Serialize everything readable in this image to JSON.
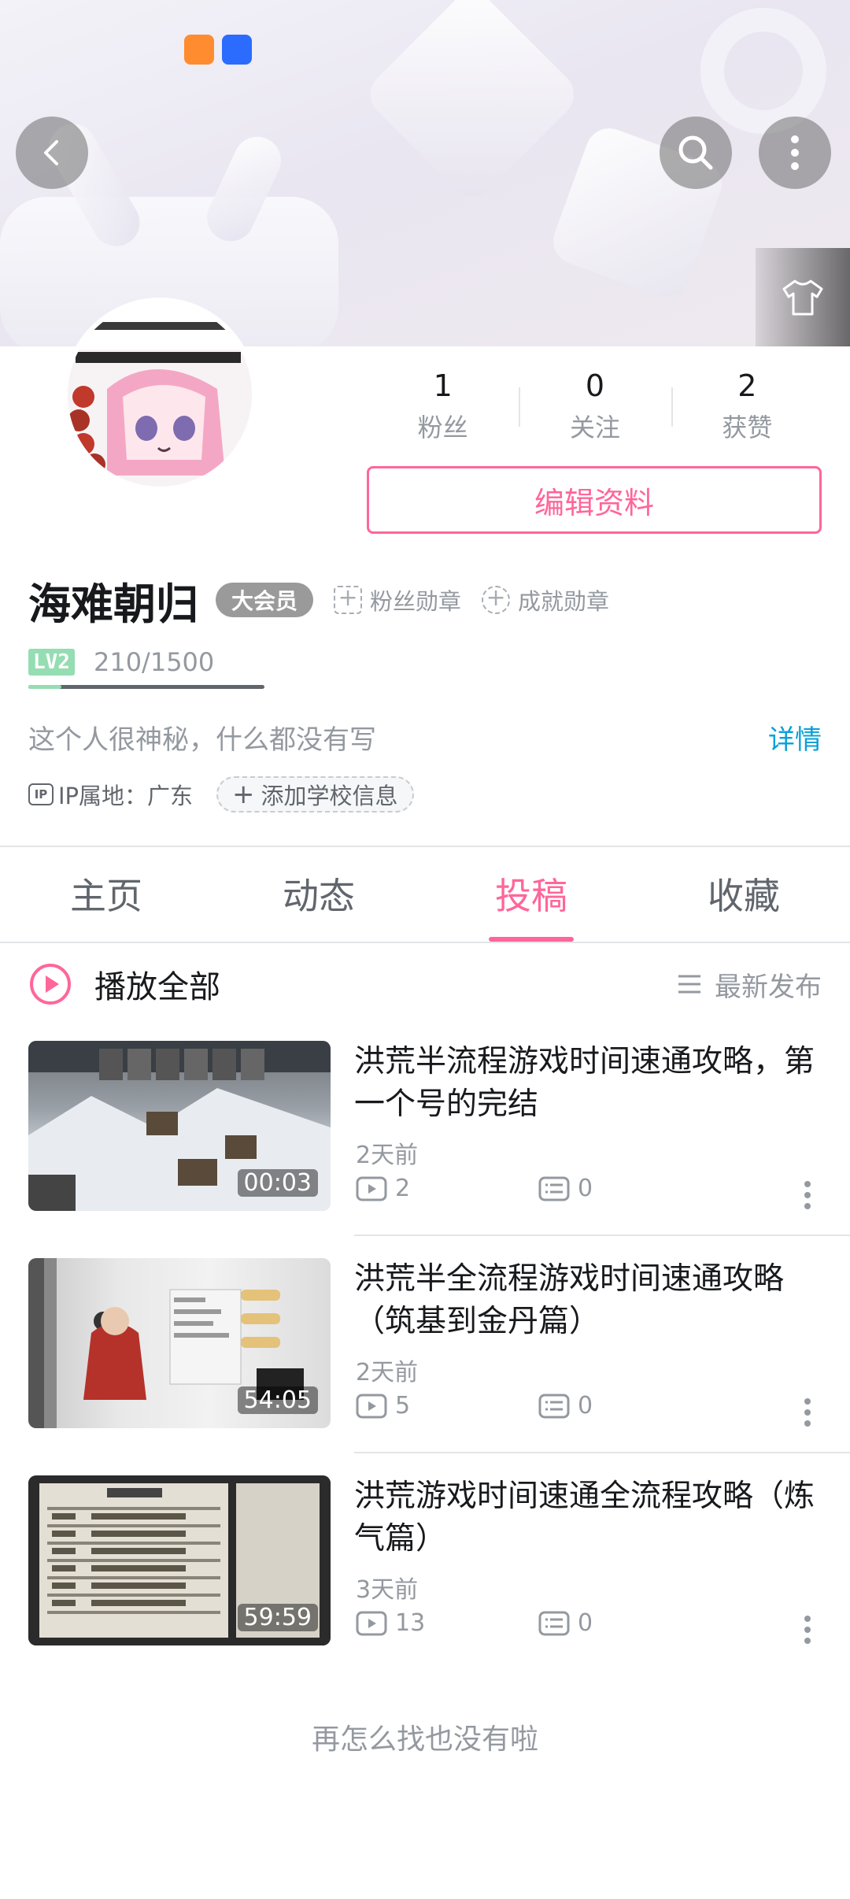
{
  "profile": {
    "username": "海难朝归",
    "vip_badge": "大会员",
    "fans_medal": "粉丝勋章",
    "achievement_medal": "成就勋章",
    "level_badge": "LV2",
    "level_exp": "210/1500",
    "level_progress": 0.14,
    "bio": "这个人很神秘，什么都没有写",
    "detail_link": "详情",
    "ip_icon_text": "IP",
    "ip_location": "IP属地：广东",
    "add_school": "添加学校信息",
    "edit_profile": "编辑资料"
  },
  "stats": [
    {
      "value": "1",
      "label": "粉丝"
    },
    {
      "value": "0",
      "label": "关注"
    },
    {
      "value": "2",
      "label": "获赞"
    }
  ],
  "tabs": [
    {
      "label": "主页",
      "active": false
    },
    {
      "label": "动态",
      "active": false
    },
    {
      "label": "投稿",
      "active": true
    },
    {
      "label": "收藏",
      "active": false
    }
  ],
  "list_header": {
    "play_all": "播放全部",
    "sort": "最新发布"
  },
  "videos": [
    {
      "title": "洪荒半流程游戏时间速通攻略，第一个号的完结",
      "time": "2天前",
      "plays": "2",
      "comments": "0",
      "duration": "00:03"
    },
    {
      "title": "洪荒半全流程游戏时间速通攻略（筑基到金丹篇）",
      "time": "2天前",
      "plays": "5",
      "comments": "0",
      "duration": "54:05"
    },
    {
      "title": "洪荒游戏时间速通全流程攻略（炼气篇）",
      "time": "3天前",
      "plays": "13",
      "comments": "0",
      "duration": "59:59"
    }
  ],
  "end_text": "再怎么找也没有啦",
  "colors": {
    "accent": "#ff6699",
    "link": "#0aa0d8",
    "secondary_text": "#9499a0",
    "level_green": "#95ddb2"
  },
  "icons": {
    "back": "back-arrow-icon",
    "search": "search-icon",
    "more": "more-vertical-icon",
    "wardrobe": "tshirt-icon",
    "play_all": "play-circle-icon",
    "sort": "list-sort-icon",
    "plays": "play-count-icon",
    "comments": "comment-icon"
  }
}
